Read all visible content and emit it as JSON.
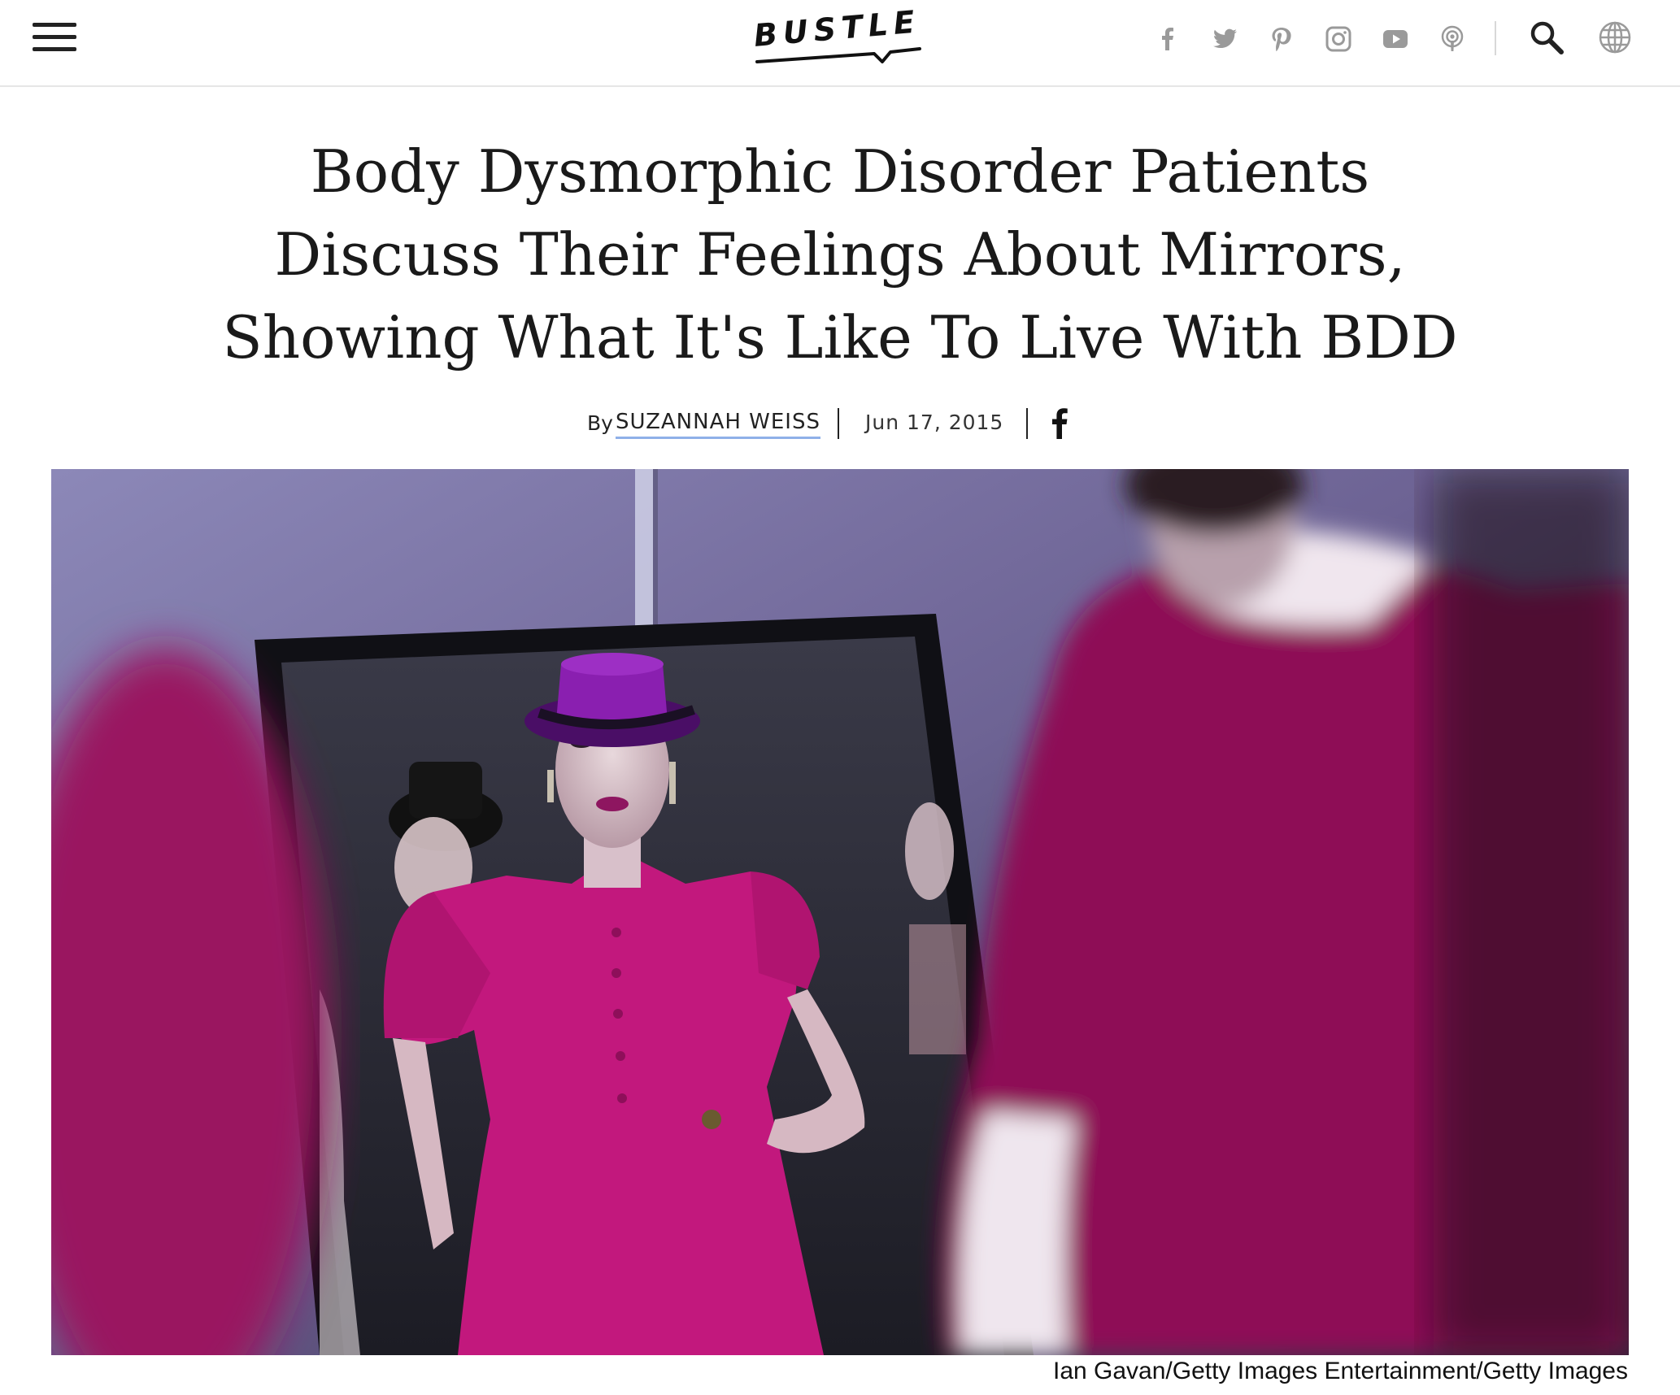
{
  "header": {
    "logo_text": "BUSTLE",
    "menu_icon": "hamburger-menu-icon",
    "social_icons": [
      "facebook-icon",
      "twitter-icon",
      "pinterest-icon",
      "instagram-icon",
      "youtube-icon",
      "podcast-icon"
    ],
    "search_icon": "search-icon",
    "globe_icon": "globe-icon",
    "icon_color": "#9a9a9a"
  },
  "article": {
    "title_lines": [
      "Body Dysmorphic Disorder Patients",
      "Discuss Their Feelings About Mirrors,",
      "Showing What It's Like To Live With BDD"
    ],
    "byline_prefix": "By",
    "author": "SUZANNAH WEISS",
    "date": "Jun 17, 2015",
    "share_icon": "facebook-share-icon",
    "link_underline_color": "#8fb0e8"
  },
  "hero": {
    "caption": "Ian Gavan/Getty Images Entertainment/Getty Images",
    "dress_color": "#c2187d",
    "hat_color": "#8a1fb0"
  }
}
